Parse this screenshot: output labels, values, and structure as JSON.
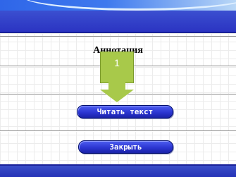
{
  "dialog": {
    "title": "Аннотация",
    "buttons": {
      "read_text": "Читать текст",
      "close": "Закрыть"
    }
  },
  "overlay": {
    "step_number": "1",
    "color": "#a8c94a"
  },
  "colors": {
    "header": "#2b34c2",
    "button": "#2c36d2"
  }
}
